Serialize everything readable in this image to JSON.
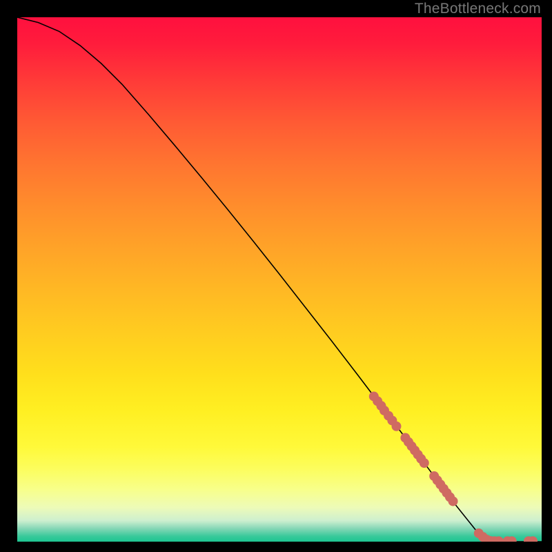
{
  "watermark": "TheBottleneck.com",
  "colors": {
    "plot_border": "#000000",
    "curve": "#000000",
    "marker_fill": "#cf6a62",
    "marker_stroke": "#cf6a62",
    "bg_top": "#ff103e",
    "bg_bottom": "#1ec592"
  },
  "chart_data": {
    "type": "line",
    "title": "",
    "xlabel": "",
    "ylabel": "",
    "xlim": [
      0,
      100
    ],
    "ylim": [
      0,
      100
    ],
    "grid": false,
    "legend": false,
    "series": [
      {
        "name": "curve",
        "x": [
          0,
          4,
          8,
          12,
          16,
          20,
          25,
          30,
          35,
          40,
          45,
          50,
          55,
          60,
          65,
          70,
          75,
          80,
          82,
          84,
          86,
          88,
          90,
          92,
          94,
          96,
          98,
          100
        ],
        "y": [
          100,
          99,
          97.3,
          94.6,
          91.2,
          87.2,
          81.5,
          75.6,
          69.6,
          63.5,
          57.3,
          51.0,
          44.6,
          38.2,
          31.7,
          25.1,
          18.5,
          11.8,
          9.0,
          6.5,
          4.0,
          1.5,
          0.4,
          0.0,
          0.0,
          0.0,
          0.0,
          0.0
        ]
      }
    ],
    "markers": [
      {
        "x": 68.0,
        "y": 27.7
      },
      {
        "x": 68.7,
        "y": 26.8
      },
      {
        "x": 69.4,
        "y": 25.9
      },
      {
        "x": 70.0,
        "y": 25.0
      },
      {
        "x": 70.8,
        "y": 24.0
      },
      {
        "x": 71.5,
        "y": 23.1
      },
      {
        "x": 72.3,
        "y": 22.0
      },
      {
        "x": 74.0,
        "y": 19.8
      },
      {
        "x": 74.6,
        "y": 19.0
      },
      {
        "x": 75.2,
        "y": 18.2
      },
      {
        "x": 75.8,
        "y": 17.4
      },
      {
        "x": 76.4,
        "y": 16.6
      },
      {
        "x": 77.0,
        "y": 15.8
      },
      {
        "x": 77.6,
        "y": 15.0
      },
      {
        "x": 79.5,
        "y": 12.5
      },
      {
        "x": 80.1,
        "y": 11.7
      },
      {
        "x": 80.7,
        "y": 10.9
      },
      {
        "x": 81.3,
        "y": 10.1
      },
      {
        "x": 81.9,
        "y": 9.3
      },
      {
        "x": 82.5,
        "y": 8.5
      },
      {
        "x": 83.1,
        "y": 7.7
      },
      {
        "x": 88.0,
        "y": 1.6
      },
      {
        "x": 88.8,
        "y": 0.9
      },
      {
        "x": 89.5,
        "y": 0.4
      },
      {
        "x": 90.2,
        "y": 0.15
      },
      {
        "x": 91.0,
        "y": 0.1
      },
      {
        "x": 91.8,
        "y": 0.1
      },
      {
        "x": 93.5,
        "y": 0.1
      },
      {
        "x": 94.3,
        "y": 0.1
      },
      {
        "x": 97.5,
        "y": 0.1
      },
      {
        "x": 98.3,
        "y": 0.1
      }
    ]
  }
}
